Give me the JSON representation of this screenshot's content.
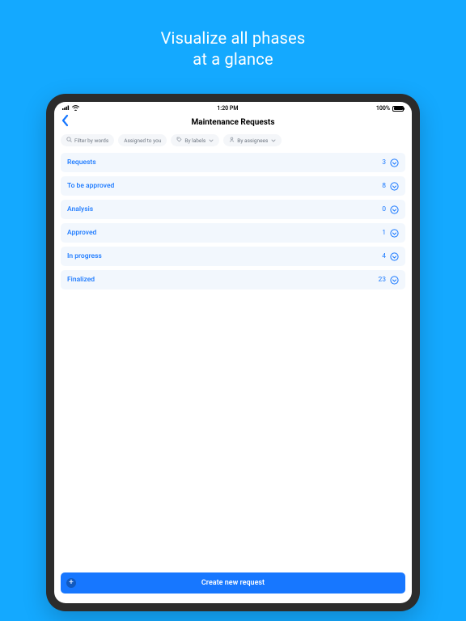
{
  "hero": {
    "line1": "Visualize all phases",
    "line2": "at a glance"
  },
  "statusbar": {
    "time": "1:20 PM",
    "battery": "100%"
  },
  "nav": {
    "title": "Maintenance Requests"
  },
  "filters": {
    "search": "Filter by words",
    "assigned": "Assigned to you",
    "labels": "By labels",
    "assignees": "By assignees"
  },
  "phases": [
    {
      "label": "Requests",
      "count": "3"
    },
    {
      "label": "To be approved",
      "count": "8"
    },
    {
      "label": "Analysis",
      "count": "0"
    },
    {
      "label": "Approved",
      "count": "1"
    },
    {
      "label": "In progress",
      "count": "4"
    },
    {
      "label": "Finalized",
      "count": "23"
    }
  ],
  "create_button": "Create new request"
}
